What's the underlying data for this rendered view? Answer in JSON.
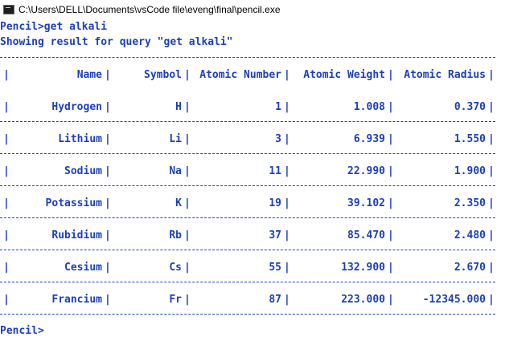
{
  "window": {
    "title": "C:\\Users\\DELL\\Documents\\vsCode file\\eveng\\final\\pencil.exe",
    "icon": "console-app-icon"
  },
  "console": {
    "command_line": "Pencil>get alkali",
    "result_line": "Showing result for query \"get alkali\"",
    "prompt": "Pencil>",
    "text_color": "#1c3fb8",
    "table": {
      "headers": [
        "Name",
        "Symbol",
        "Atomic Number",
        "Atomic Weight",
        "Atomic Radius"
      ],
      "rows": [
        [
          "Hydrogen",
          "H",
          "1",
          "1.008",
          "0.370"
        ],
        [
          "Lithium",
          "Li",
          "3",
          "6.939",
          "1.550"
        ],
        [
          "Sodium",
          "Na",
          "11",
          "22.990",
          "1.900"
        ],
        [
          "Potassium",
          "K",
          "19",
          "39.102",
          "2.350"
        ],
        [
          "Rubidium",
          "Rb",
          "37",
          "85.470",
          "2.480"
        ],
        [
          "Cesium",
          "Cs",
          "55",
          "132.900",
          "2.670"
        ],
        [
          "Francium",
          "Fr",
          "87",
          "223.000",
          "-12345.000"
        ]
      ]
    }
  }
}
